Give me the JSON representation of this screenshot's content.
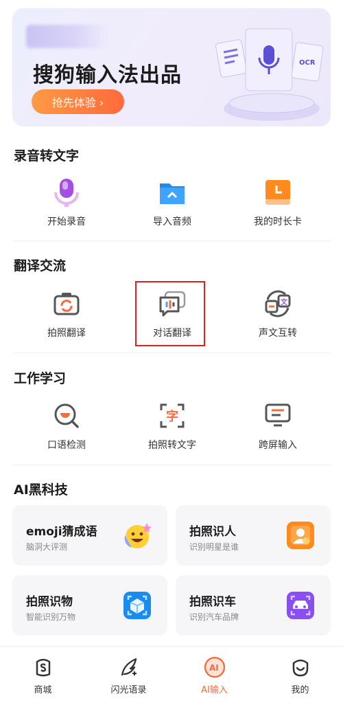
{
  "banner": {
    "title": "搜狗输入法出品",
    "cta": "抢先体验 ›"
  },
  "sections": {
    "record": {
      "title": "录音转文字",
      "items": [
        {
          "label": "开始录音",
          "icon": "microphone-icon"
        },
        {
          "label": "导入音频",
          "icon": "folder-icon"
        },
        {
          "label": "我的时长卡",
          "icon": "clock-card-icon"
        }
      ]
    },
    "translate": {
      "title": "翻译交流",
      "items": [
        {
          "label": "拍照翻译",
          "icon": "camera-translate-icon"
        },
        {
          "label": "对话翻译",
          "icon": "dialog-translate-icon"
        },
        {
          "label": "声文互转",
          "icon": "voice-text-icon"
        }
      ]
    },
    "study": {
      "title": "工作学习",
      "items": [
        {
          "label": "口语检测",
          "icon": "speech-check-icon"
        },
        {
          "label": "拍照转文字",
          "icon": "photo-to-text-icon"
        },
        {
          "label": "跨屏输入",
          "icon": "cross-screen-icon"
        }
      ]
    },
    "ai": {
      "title": "AI黑科技",
      "cards": [
        {
          "title": "emoji猜成语",
          "sub": "脑洞大评测",
          "icon": "emoji-icon"
        },
        {
          "title": "拍照识人",
          "sub": "识别明星是谁",
          "icon": "person-id-icon"
        },
        {
          "title": "拍照识物",
          "sub": "智能识别万物",
          "icon": "object-id-icon"
        },
        {
          "title": "拍照识车",
          "sub": "识别汽车品牌",
          "icon": "car-id-icon"
        }
      ]
    }
  },
  "tabs": [
    {
      "label": "商城",
      "icon": "shop-icon"
    },
    {
      "label": "闪光语录",
      "icon": "quill-icon"
    },
    {
      "label": "AI输入",
      "icon": "ai-icon",
      "active": true
    },
    {
      "label": "我的",
      "icon": "profile-icon"
    }
  ],
  "colors": {
    "accent": "#f46a3c",
    "highlight_box": "#e02020"
  }
}
